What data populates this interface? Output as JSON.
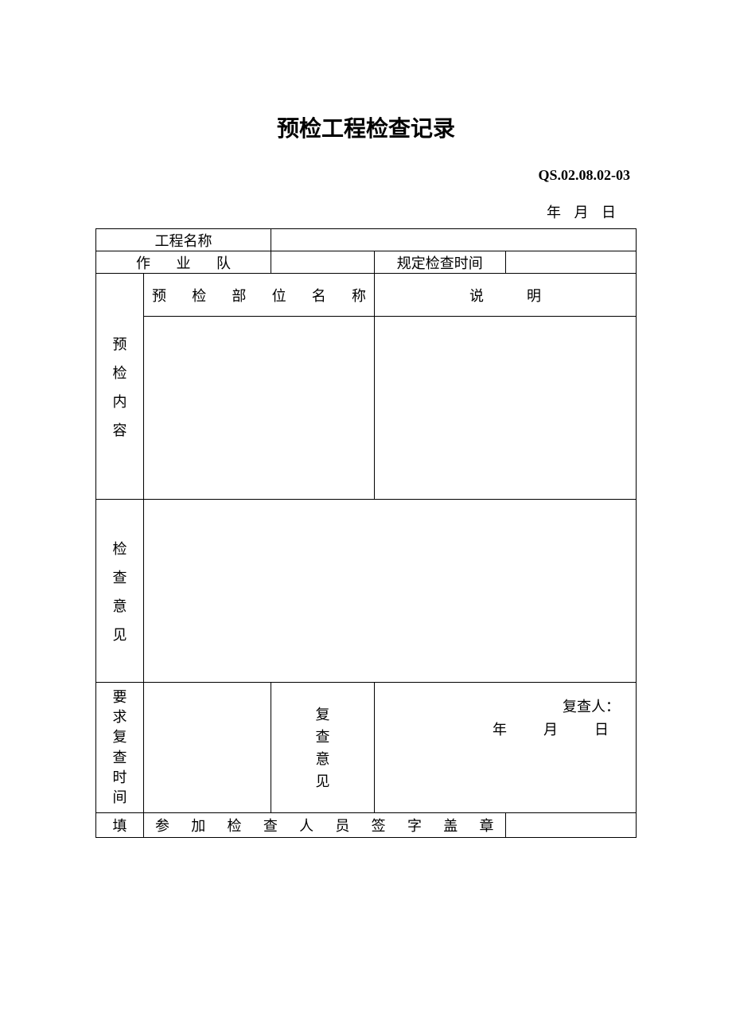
{
  "title": "预检工程检查记录",
  "doc_code": "QS.02.08.02-03",
  "top_date": "年 月 日",
  "labels": {
    "project_name": "工程名称",
    "work_team": "作 业 队",
    "scheduled_time": "规定检查时间",
    "precheck_unit_name": "预 检 部 位 名 称",
    "explanation": "说　　　明",
    "precheck_content": "预检内容",
    "inspection_opinion": "检查意见",
    "recheck_time_req": "要求复查时间",
    "recheck_opinion": "复查意见",
    "rechecker_label": "复查人：",
    "recheck_date": "年　月　日",
    "fill": "填",
    "sign_stamp": "参 加 检 查 人 员 签 字 盖 章"
  },
  "values": {
    "project_name": "",
    "work_team": "",
    "scheduled_time": "",
    "precheck_unit_name": "",
    "explanation": "",
    "precheck_content_left": "",
    "precheck_content_right": "",
    "inspection_opinion": "",
    "recheck_time_req": "",
    "recheck_opinion": "",
    "rechecker_name": ""
  }
}
